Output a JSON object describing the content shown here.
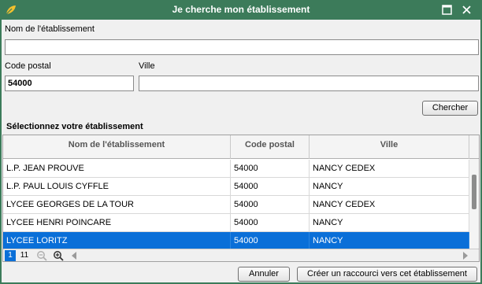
{
  "window": {
    "title": "Je cherche mon établissement",
    "maximize_icon": "maximize-icon",
    "close_icon": "close-icon",
    "app_icon": "leaf-icon"
  },
  "form": {
    "name_label": "Nom de l'établissement",
    "name_value": "",
    "postal_label": "Code postal",
    "postal_value": "54000",
    "city_label": "Ville",
    "city_value": "",
    "search_label": "Chercher"
  },
  "results": {
    "section_title": "Sélectionnez votre établissement",
    "columns": [
      "Nom de l'établissement",
      "Code postal",
      "Ville"
    ],
    "rows": [
      {
        "name": "L.P. JEAN PROUVE",
        "postal": "54000",
        "city": "NANCY CEDEX"
      },
      {
        "name": "L.P. PAUL LOUIS CYFFLE",
        "postal": "54000",
        "city": "NANCY"
      },
      {
        "name": "LYCEE GEORGES DE LA TOUR",
        "postal": "54000",
        "city": "NANCY CEDEX"
      },
      {
        "name": "LYCEE HENRI POINCARE",
        "postal": "54000",
        "city": "NANCY"
      },
      {
        "name": "LYCEE LORITZ",
        "postal": "54000",
        "city": "NANCY"
      }
    ],
    "selected_row": 4,
    "pages": [
      "1",
      "11"
    ],
    "zoom_out_icon": "zoom-out-icon",
    "zoom_in_icon": "zoom-in-icon"
  },
  "actions": {
    "cancel_label": "Annuler",
    "shortcut_label": "Créer un raccourci vers cet établissement"
  },
  "colors": {
    "titlebar": "#3c7b5a",
    "selection": "#0a6fd8"
  }
}
